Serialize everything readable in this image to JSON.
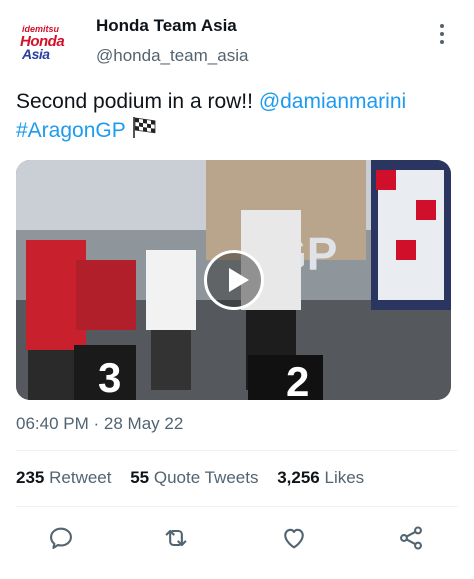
{
  "account": {
    "avatar_brand_small": "idemitsu",
    "avatar_brand_main": "Honda",
    "avatar_brand_sub": "Asia",
    "name": "Honda Team Asia",
    "handle": "@honda_team_asia"
  },
  "tweet": {
    "text_prefix": "Second podium in a row!! ",
    "mention": "@damianmarini",
    "hashtag": "#AragonGP",
    "flag_icon": "chequered-flag-icon",
    "media_type": "video",
    "time": "06:40 PM",
    "date": "28 May 22",
    "separator": "·"
  },
  "stats": {
    "retweets": "235",
    "retweets_label": "Retweet",
    "quotes": "55",
    "quotes_label": "Quote Tweets",
    "likes": "3,256",
    "likes_label": "Likes"
  },
  "actions": [
    "reply-icon",
    "retweet-icon",
    "like-icon",
    "share-icon"
  ],
  "colors": {
    "text": "#0f1419",
    "secondary": "#536471",
    "link": "#1d9bf0",
    "brand_red": "#d3102a",
    "brand_blue": "#2a3f9f"
  }
}
